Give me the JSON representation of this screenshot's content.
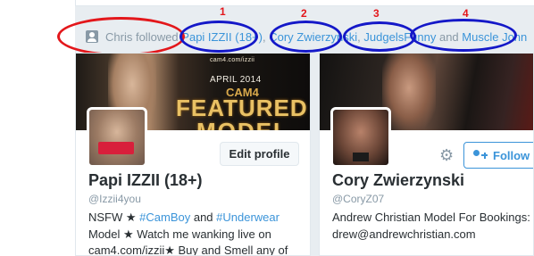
{
  "context": {
    "user": "Chris",
    "verb": "followed",
    "links": [
      "Papi IZZII (18+)",
      "Cory Zwierzynski",
      "JudgelsFunny",
      "Muscle John"
    ],
    "separators": [
      ", ",
      ", ",
      " and "
    ]
  },
  "annotations": {
    "numbers": [
      "1",
      "2",
      "3",
      "4"
    ],
    "colors": {
      "red": "#e3171b",
      "blue": "#1418c8"
    }
  },
  "card1": {
    "banner": {
      "small": "cam4.com/izzii",
      "date": "APRIL 2014",
      "brand": "CAM4",
      "line1": "FEATURED",
      "line2": "MODEL"
    },
    "button": "Edit profile",
    "name": "Papi IZZII (18+)",
    "handle": "@Izzii4you",
    "bio": {
      "l1a": "NSFW ★ ",
      "l1b": "#CamBoy",
      "l1c": " and ",
      "l1d": "#Underwear",
      "l2": "Model ★ Watch me wanking live on",
      "l3a": "cam4.com/izzii",
      "l3b": "★ Buy and Smell any of"
    }
  },
  "card2": {
    "button": "Follow",
    "name": "Cory Zwierzynski",
    "handle": "@CoryZ07",
    "bio": {
      "l1": "Andrew Christian Model For Bookings:",
      "l2": "drew@andrewchristian.com"
    }
  },
  "icons": {
    "context": "person-icon",
    "gear": "gear-icon",
    "follow": "follow-person-icon"
  }
}
